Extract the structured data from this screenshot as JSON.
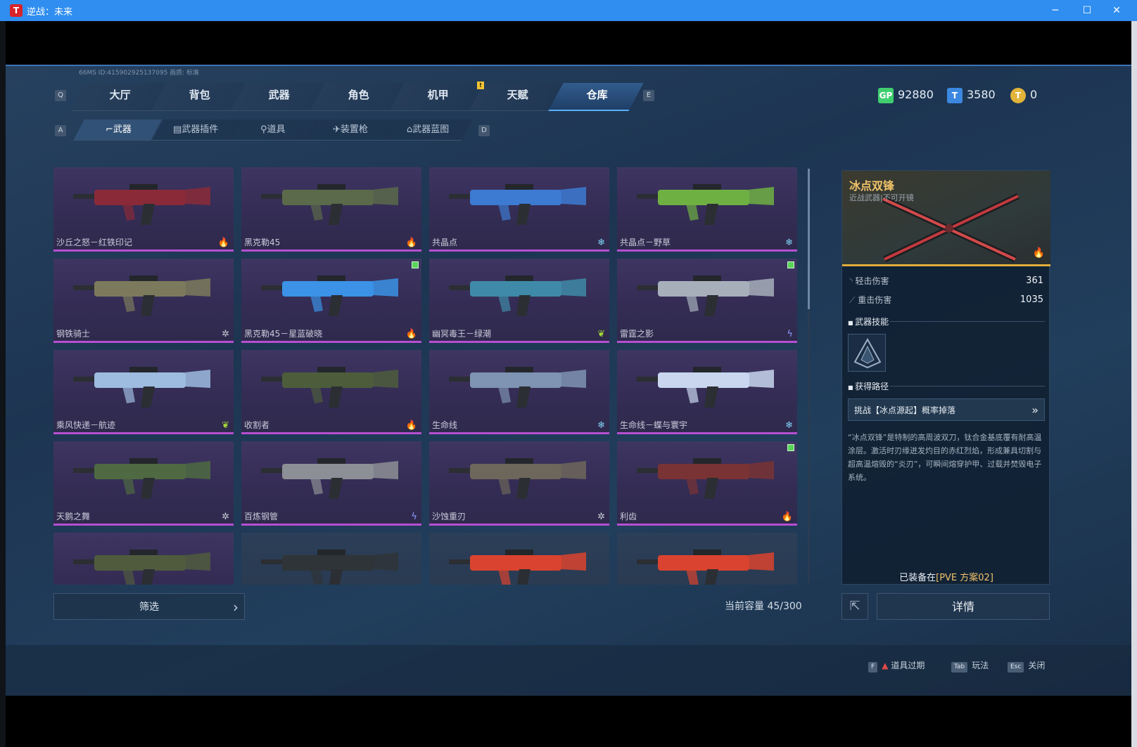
{
  "window": {
    "title": "逆战：未来",
    "controls": [
      "─",
      "☐",
      "✕"
    ]
  },
  "status": "66MS  ID:415902925137095  画质: 标准",
  "keys": {
    "left_tab": "Q",
    "right_tab": "E",
    "left_sub": "A",
    "right_sub": "D"
  },
  "main_tabs": [
    "大厅",
    "背包",
    "武器",
    "角色",
    "机甲",
    "天赋",
    "仓库"
  ],
  "main_tab_active": "仓库",
  "tab_alert": "!",
  "currency": [
    {
      "icon": "gp-icon",
      "label": "GP",
      "value": "92880",
      "color": "#3fcf6f"
    },
    {
      "icon": "ticket-icon",
      "label": "T",
      "value": "3580",
      "color": "#3c88e0"
    },
    {
      "icon": "coin-icon",
      "label": "T",
      "value": "0",
      "color": "#e2b43a"
    }
  ],
  "sub_tabs": [
    "武器",
    "武器插件",
    "道具",
    "装置枪",
    "武器蓝图"
  ],
  "sub_tab_active": "武器",
  "weapons": [
    {
      "name": "沙丘之怒－红铁印记",
      "rarity": "fire",
      "gun": "#8a2a38",
      "tag": false
    },
    {
      "name": "黑克勒45",
      "rarity": "fire",
      "gun": "#5b6a4a",
      "tag": false
    },
    {
      "name": "共晶点",
      "rarity": "snow",
      "gun": "#3d7ad2",
      "tag": false
    },
    {
      "name": "共晶点－野草",
      "rarity": "snow",
      "gun": "#6fb043",
      "tag": false
    },
    {
      "name": "钢铁骑士",
      "rarity": "gear",
      "gun": "#7c7a5c",
      "tag": false
    },
    {
      "name": "黑克勒45－星蓝破晓",
      "rarity": "fire",
      "gun": "#3b92e6",
      "tag": true
    },
    {
      "name": "幽冥毒王－绿潮",
      "rarity": "leaf",
      "gun": "#3f8aa8",
      "tag": false
    },
    {
      "name": "雷霆之影",
      "rarity": "bolt",
      "gun": "#a7afbb",
      "tag": true
    },
    {
      "name": "乘风快递－航迹",
      "rarity": "leaf",
      "gun": "#9ebbe0",
      "tag": false
    },
    {
      "name": "收割者",
      "rarity": "fire",
      "gun": "#4d5d3c",
      "tag": false
    },
    {
      "name": "生命线",
      "rarity": "snow",
      "gun": "#7f93b3",
      "tag": false
    },
    {
      "name": "生命线－蝶与寰宇",
      "rarity": "snow",
      "gun": "#c9d6ee",
      "tag": false
    },
    {
      "name": "天鹅之舞",
      "rarity": "gear",
      "gun": "#4f6a42",
      "tag": false
    },
    {
      "name": "百炼钢管",
      "rarity": "bolt",
      "gun": "#8d8f96",
      "tag": false
    },
    {
      "name": "沙蚀重刃",
      "rarity": "gear",
      "gun": "#6d665a",
      "tag": false
    },
    {
      "name": "利齿",
      "rarity": "fire",
      "gun": "#7a3334",
      "tag": true
    },
    {
      "name": "",
      "rarity": "",
      "gun": "#505b3e",
      "tag": false
    },
    {
      "name": "",
      "rarity": "",
      "gun": "#2f3438",
      "tag": false
    },
    {
      "name": "",
      "rarity": "",
      "gun": "#d9432f",
      "tag": false
    },
    {
      "name": "",
      "rarity": "",
      "gun": "#d9432f",
      "tag": false
    }
  ],
  "rarity_icons": {
    "fire": "🔥",
    "snow": "❄",
    "gear": "✲",
    "leaf": "❦",
    "bolt": "ϟ"
  },
  "rarity_colors": {
    "fire": "#f2a02d",
    "snow": "#7fd3f5",
    "gear": "#c9ced6",
    "leaf": "#a4d639",
    "bolt": "#8c9cff"
  },
  "filter": {
    "label": "筛选",
    "chevron": "›"
  },
  "capacity": "当前容量 45/300",
  "detail": {
    "title": "冰点双锋",
    "subtitle": "近战武器|不可开镜",
    "stats": [
      {
        "label": "轻击伤害",
        "value": "361"
      },
      {
        "label": "重击伤害",
        "value": "1035"
      }
    ],
    "skill_title": "武器技能",
    "route_title": "获得路径",
    "route": "挑战【冰点源起】概率掉落",
    "route_chevron": "»",
    "description": "“冰点双锋”是特制的高周波双刀，钛合金基底覆有耐高温涂层。激活时刃缘迸发灼目的赤红烈焰，形成兼具切割与超高温熔毁的“炎刃”，可瞬间熔穿护甲、过载并焚毁电子系统。",
    "equipped_prefix": "已装备在",
    "equipped_slot": "[PVE 方案02]"
  },
  "actions": {
    "share_icon": "⇱",
    "details": "详情"
  },
  "footer_hints": [
    {
      "key": "F",
      "label": "道具过期",
      "warn": "▲"
    },
    {
      "key": "Tab",
      "label": "玩法",
      "warn": ""
    },
    {
      "key": "Esc",
      "label": "关闭",
      "warn": ""
    }
  ]
}
